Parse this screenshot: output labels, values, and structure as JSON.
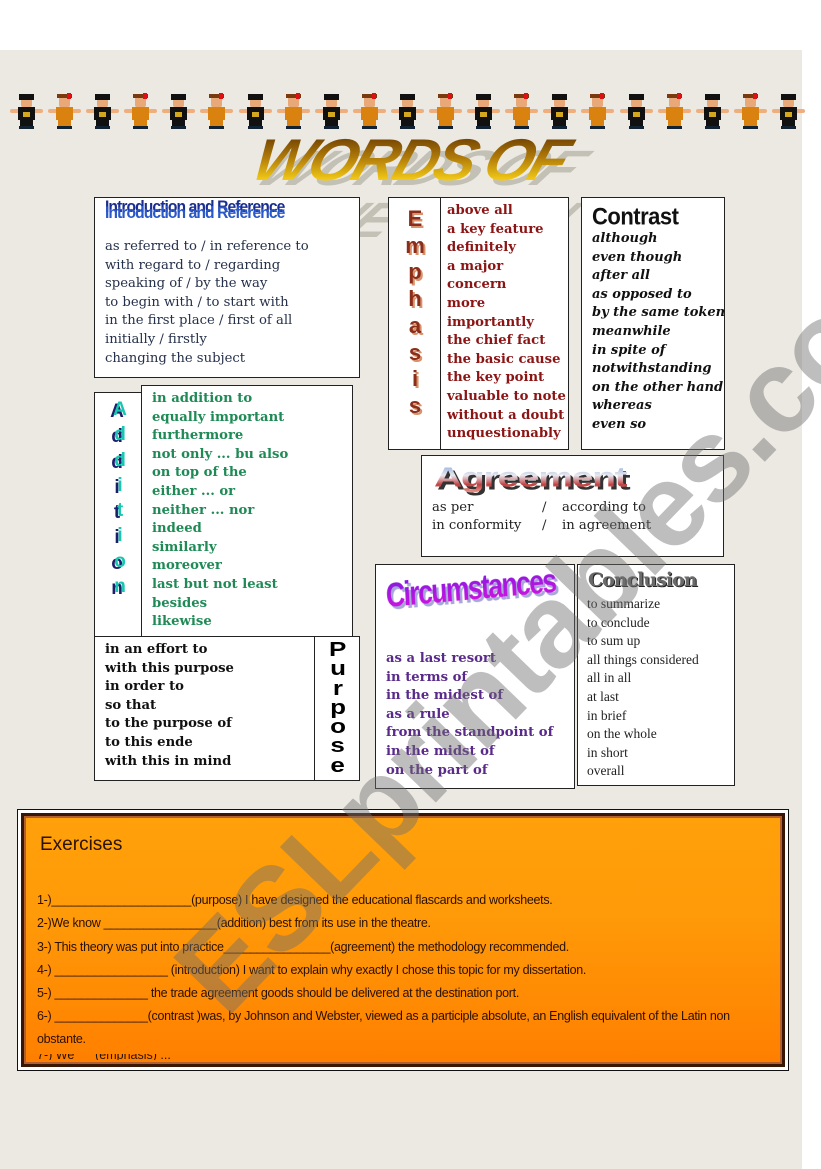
{
  "title": "WORDS OF CONNECTION",
  "border_figures": [
    "pilgrim",
    "native",
    "pilgrim",
    "native",
    "pilgrim",
    "native",
    "pilgrim",
    "native",
    "pilgrim",
    "native",
    "pilgrim",
    "native",
    "pilgrim",
    "native",
    "pilgrim",
    "native",
    "pilgrim",
    "native",
    "pilgrim",
    "native",
    "pilgrim"
  ],
  "watermark": "ESLprintables.com",
  "sections": {
    "introduction": {
      "heading": "Introduction and Reference",
      "items": [
        "as referred to  / in reference to",
        "with regard to / regarding",
        "speaking of   / by the way",
        "to begin with / to start with",
        "in the first place / first of all",
        "initially  / firstly",
        "changing the subject"
      ]
    },
    "emphasis": {
      "heading_letters": [
        "E",
        "m",
        "p",
        "h",
        "a",
        "s",
        "i",
        "s"
      ],
      "items": [
        "above all",
        "a key feature",
        "definitely",
        "a major",
        "concern",
        "more",
        "importantly",
        "the chief fact",
        "the basic cause",
        "the key point",
        "valuable to note",
        "without a doubt",
        "unquestionably"
      ]
    },
    "contrast": {
      "heading": "Contrast",
      "items": [
        "although",
        "even though",
        "after all",
        "as opposed to",
        "by the same token",
        "meanwhile",
        "in spite of",
        "notwithstanding",
        "on the other hand",
        "whereas",
        "even so"
      ]
    },
    "addition": {
      "heading_letters": [
        "A",
        "d",
        "d",
        "i",
        "t",
        "i",
        "o",
        "n"
      ],
      "items": [
        "in addition to",
        "equally important",
        "furthermore",
        "not only ... bu also",
        "on top of the",
        "either ... or",
        "neither ... nor",
        "indeed",
        "similarly",
        "moreover",
        "last but not least",
        "besides",
        "likewise"
      ]
    },
    "purpose": {
      "heading_letters": [
        "P",
        "u",
        "r",
        "p",
        "o",
        "s",
        "e"
      ],
      "items": [
        "in an effort to",
        "with this purpose",
        "in order to",
        "so that",
        "to the purpose of",
        "to this ende",
        "with this in mind"
      ]
    },
    "agreement": {
      "heading": "Agreement",
      "rows": [
        {
          "left": "as per",
          "sep": "/",
          "right": "according to"
        },
        {
          "left": "in conformity",
          "sep": "/",
          "right": "in agreement"
        }
      ]
    },
    "circumstances": {
      "heading": "Circumstances",
      "items": [
        "as a last resort",
        "in terms of",
        "in the midest of",
        "as a rule",
        "from the standpoint of",
        "in the midst of",
        "on the part of"
      ]
    },
    "conclusion": {
      "heading": "Conclusion",
      "items": [
        "to summarize",
        "to conclude",
        "to sum up",
        "all things considered",
        "all in all",
        "at last",
        "in brief",
        "on the whole",
        "in short",
        "overall"
      ]
    }
  },
  "exercises": {
    "heading": "Exercises",
    "items": [
      "1-)_____________________(purpose) I have designed the educational flascards and worksheets.",
      "2-)We know _________________(addition) best from its use in the theatre.",
      "3-) This theory was put into practice________________(agreement) the methodology recommended.",
      "4-) _________________ (introduction) I want to explain why exactly I chose this topic for my dissertation.",
      "5-) ______________ the trade agreement goods should be delivered at the destination port.",
      "6-)  ______________(contrast )was, by Johnson and Webster, viewed as a participle absolute, an English equivalent of the Latin non obstante."
    ],
    "cut_line": "7-) We __                              (emphasis) ..."
  },
  "colors": {
    "page_bg": "#ece9e2",
    "intro_text": "#25304a",
    "emphasis_text": "#8b1414",
    "addition_text": "#1f8a55",
    "circumstances_text": "#5a2a8a",
    "exercise_bg": "#ff9a08"
  }
}
